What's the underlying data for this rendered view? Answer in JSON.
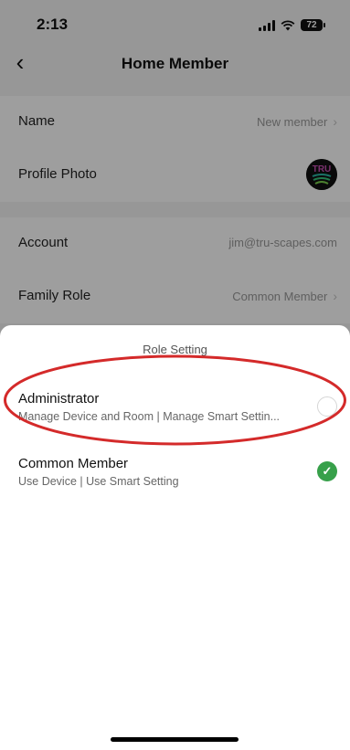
{
  "status_bar": {
    "time": "2:13",
    "battery": "72"
  },
  "header": {
    "title": "Home Member",
    "back_icon": "chevron-left-icon"
  },
  "member_info": [
    {
      "label": "Name",
      "value": "New member"
    },
    {
      "label": "Profile Photo",
      "avatar_text": "TRU"
    }
  ],
  "member_account": [
    {
      "label": "Account",
      "value": "jim@tru-scapes.com"
    },
    {
      "label": "Family Role",
      "value": "Common Member"
    }
  ],
  "role_sheet": {
    "title": "Role Setting",
    "options": [
      {
        "title": "Administrator",
        "description": "Manage Device and Room | Manage Smart Settin...",
        "selected": false
      },
      {
        "title": "Common Member",
        "description": "Use Device | Use Smart Setting",
        "selected": true
      }
    ],
    "check_color": "#37a04a",
    "annotation_color": "#d42a2a"
  }
}
